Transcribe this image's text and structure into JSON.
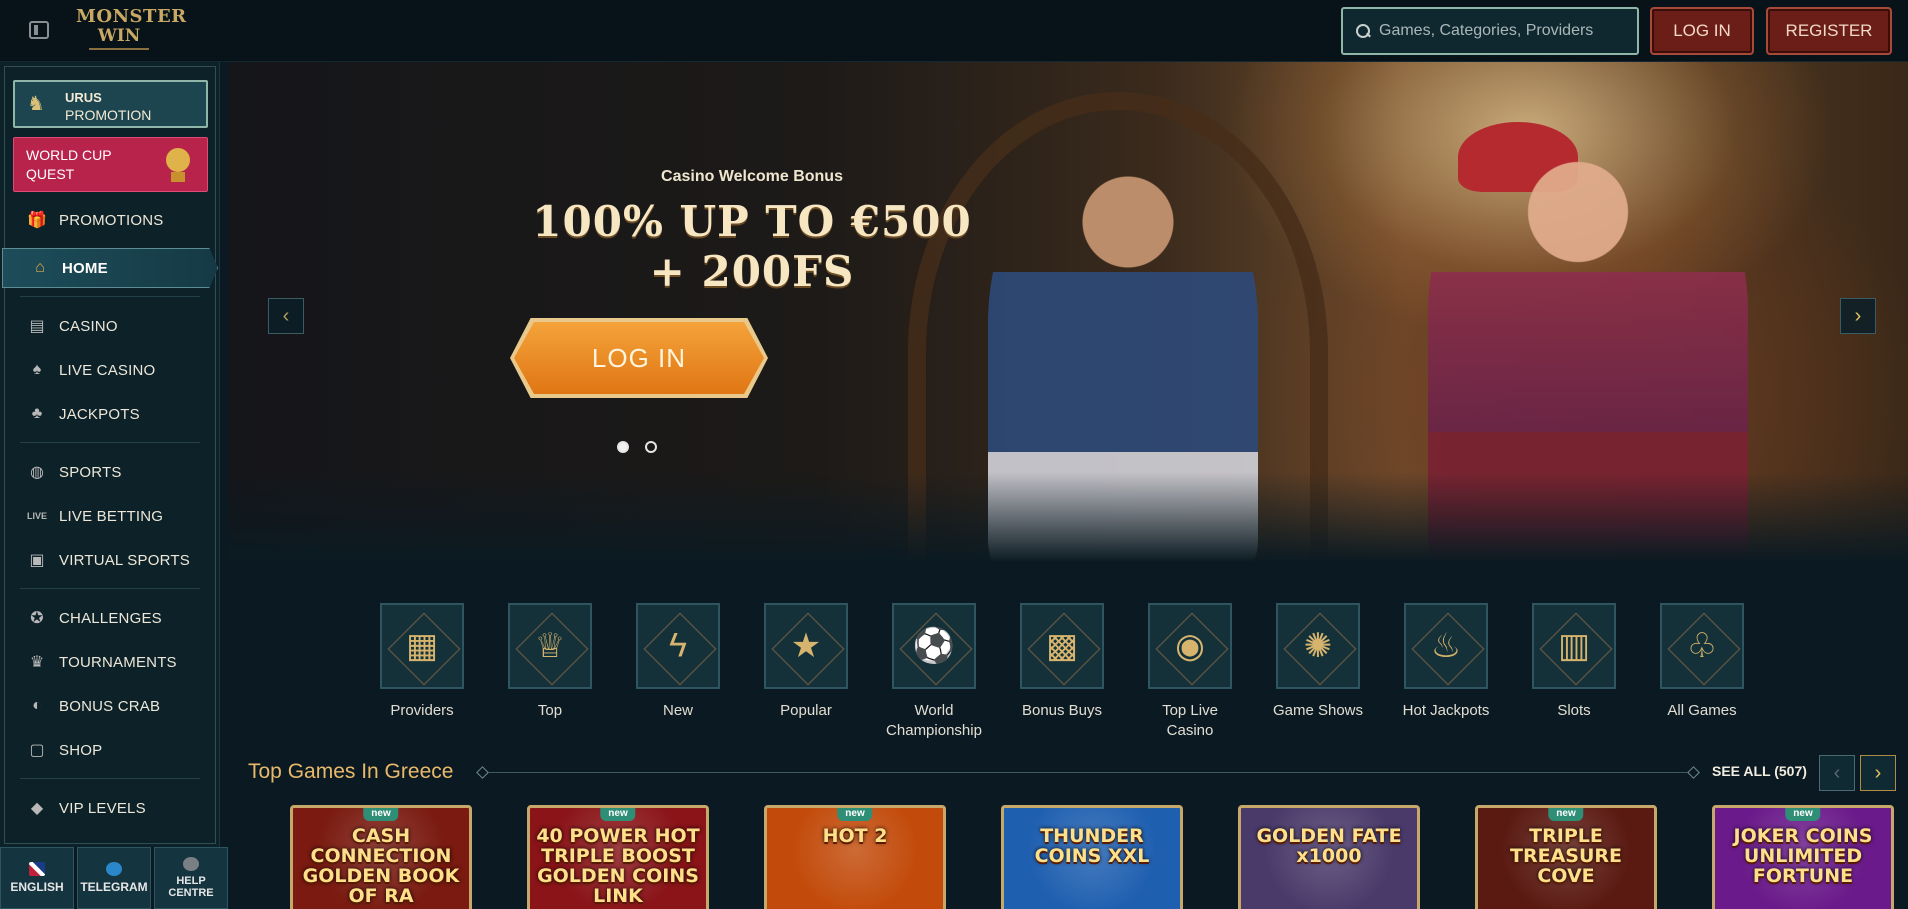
{
  "header": {
    "logo_line1": "MONSTER",
    "logo_line2": "WIN",
    "search_placeholder": "Games, Categories, Providers",
    "login_label": "LOG IN",
    "register_label": "REGISTER"
  },
  "sidebar": {
    "promo_urus": {
      "line1": "URUS",
      "line2": "PROMOTION"
    },
    "promo_worldcup": "WORLD CUP QUEST",
    "items": [
      {
        "label": "PROMOTIONS",
        "icon": "gift-icon"
      },
      {
        "label": "HOME",
        "icon": "home-icon"
      },
      {
        "label": "CASINO",
        "icon": "slot-machine-icon"
      },
      {
        "label": "LIVE CASINO",
        "icon": "cards-icon"
      },
      {
        "label": "JACKPOTS",
        "icon": "clover-icon"
      },
      {
        "label": "SPORTS",
        "icon": "ball-icon"
      },
      {
        "label": "LIVE BETTING",
        "icon": "live-icon"
      },
      {
        "label": "VIRTUAL SPORTS",
        "icon": "virtual-icon"
      },
      {
        "label": "CHALLENGES",
        "icon": "challenge-icon"
      },
      {
        "label": "TOURNAMENTS",
        "icon": "trophy-icon"
      },
      {
        "label": "BONUS CRAB",
        "icon": "crab-icon"
      },
      {
        "label": "SHOP",
        "icon": "shop-icon"
      },
      {
        "label": "VIP LEVELS",
        "icon": "diamond-icon"
      }
    ],
    "bottom": [
      {
        "label": "ENGLISH",
        "icon": "flag-uk-icon"
      },
      {
        "label": "TELEGRAM",
        "icon": "telegram-icon"
      },
      {
        "label": "HELP CENTRE",
        "icon": "help-icon"
      }
    ]
  },
  "hero": {
    "subtitle": "Casino Welcome Bonus",
    "title_line1": "100% UP TO €500",
    "title_line2": "+ 200FS",
    "cta": "LOG IN",
    "slide_count": 2,
    "active_slide": 1
  },
  "categories": [
    {
      "label": "Providers",
      "icon": "book-icon"
    },
    {
      "label": "Top",
      "icon": "crown-icon"
    },
    {
      "label": "New",
      "icon": "lightning-icon"
    },
    {
      "label": "Popular",
      "icon": "star-icon"
    },
    {
      "label": "World Championship",
      "icon": "football-icon"
    },
    {
      "label": "Bonus Buys",
      "icon": "chest-icon"
    },
    {
      "label": "Top Live Casino",
      "icon": "chip-icon"
    },
    {
      "label": "Game Shows",
      "icon": "wheel-icon"
    },
    {
      "label": "Hot Jackpots",
      "icon": "flame-icon"
    },
    {
      "label": "Slots",
      "icon": "slot-icon"
    },
    {
      "label": "All Games",
      "icon": "cherries-icon"
    }
  ],
  "top_games": {
    "title": "Top Games In Greece",
    "see_all": "SEE ALL (507)",
    "games": [
      {
        "title": "CASH CONNECTION GOLDEN BOOK OF RA",
        "badge": "new",
        "bg": "#7a1a10"
      },
      {
        "title": "40 POWER HOT TRIPLE BOOST GOLDEN COINS LINK",
        "badge": "new",
        "bg": "#8a1418"
      },
      {
        "title": "HOT 2",
        "badge": "new",
        "bg": "#c24a0a"
      },
      {
        "title": "THUNDER COINS XXL",
        "badge": "",
        "bg": "#1f5fb0"
      },
      {
        "title": "GOLDEN FATE x1000",
        "badge": "",
        "bg": "#4a3a6a"
      },
      {
        "title": "TRIPLE TREASURE COVE",
        "badge": "new",
        "bg": "#5a1a12"
      },
      {
        "title": "JOKER COINS UNLIMITED FORTUNE",
        "badge": "new",
        "bg": "#6a1a8a"
      }
    ]
  }
}
